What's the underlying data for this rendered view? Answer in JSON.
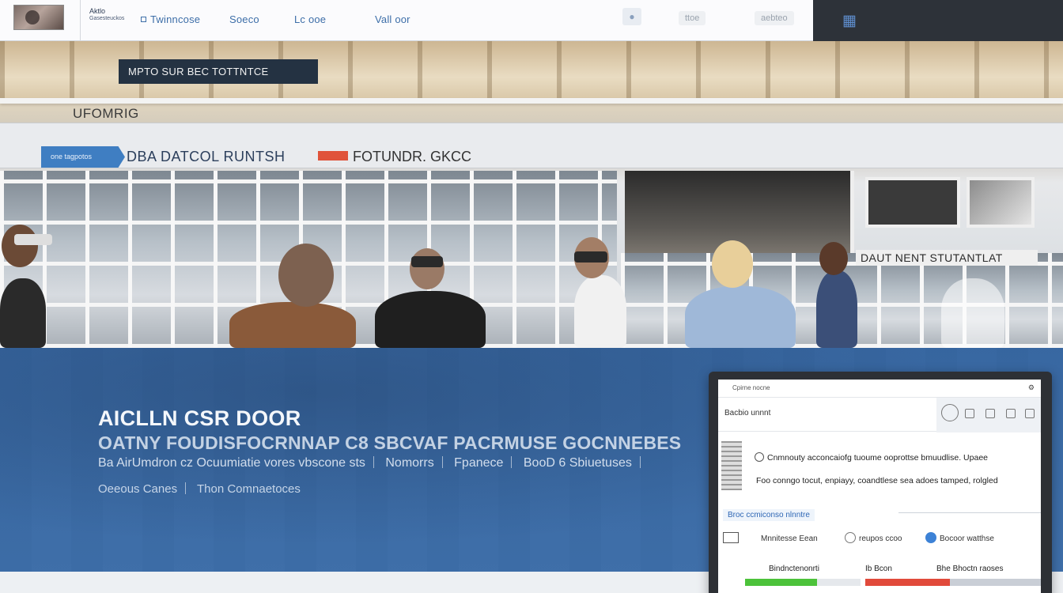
{
  "nav": {
    "brand_line1": "Aktlo",
    "brand_line2": "Gasesteuckos",
    "links": [
      "Twinncose",
      "Soeco",
      "Lc ooe",
      "Vall oor"
    ],
    "pill_1": "ttoe",
    "pill_2": "aebteo"
  },
  "hero": {
    "sign_dark": "MPTO SUR BEC TOTTNTCE",
    "sign_wall": "UFOMRIG",
    "sign_tag": "one tagpotos",
    "sign_main": "DBA DATCOL RUNTSH",
    "sign_accent": "FOTUNDR. GKCC",
    "sign_right": "DAUT NENT STUTANTLAT"
  },
  "band": {
    "title": "AICLLN CSR DOOR",
    "subtitle": "OATNY FOUDISFOCRNNAP C8 SBCVAF PACRMUSE GOCNNEBES",
    "lead_items": [
      "Ba AirUmdron cz Ocuumiatie vores vbscone sts",
      "Nomorrs",
      "Fpanece",
      "BooD 6 Sbiuetuses"
    ],
    "links": [
      "Oeeous Canes",
      "Thon Comnaetoces"
    ]
  },
  "device": {
    "top_label": "Cpirne nocne",
    "title": "Bacbio unnnt",
    "row_1": "Cnmnouty acconcaiofg tuoume ooprottse bmuudlise. Upaee",
    "row_2": "Foo conngo tocut, enpiayy, coandtlese sea adoes tamped, rolgled",
    "link": "Broc ccmiconso nlnntre",
    "chip_1": "Mnnitesse Eean",
    "chip_2": "reupos ccoo",
    "chip_3": "Bocoor watthse",
    "table_1": "Bindnctenonrti",
    "table_2": "Ib Bcon",
    "table_3": "Bhe Bhoctn raoses",
    "progress": [
      0.62,
      0.48
    ],
    "colors": {
      "progress_green": "#4cc23a",
      "progress_red": "#e14a3b",
      "chip_blue": "#3d82d6"
    }
  },
  "colors": {
    "band_blue": "#3d6fa9",
    "accent_red": "#e0533a",
    "nav_link": "#3d6ea8"
  }
}
